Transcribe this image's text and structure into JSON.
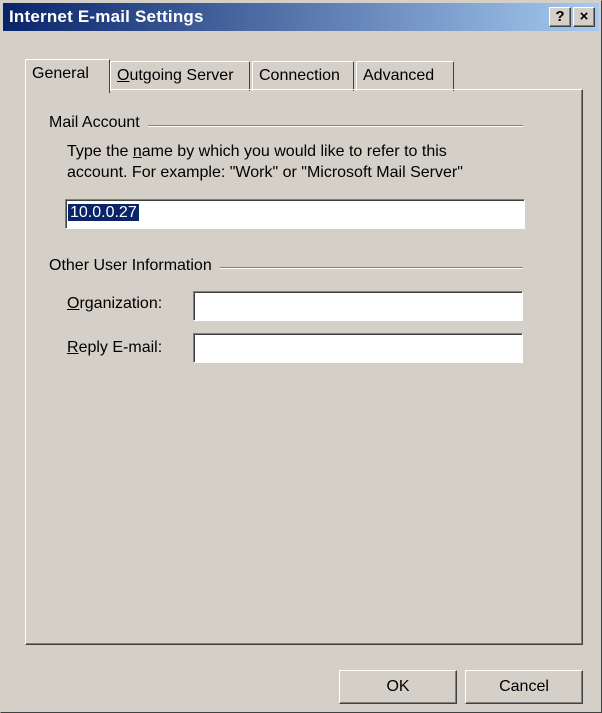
{
  "window": {
    "title": "Internet E-mail Settings",
    "help_label": "?",
    "close_label": "×"
  },
  "tabs": [
    {
      "label": "General",
      "active": true
    },
    {
      "label": "Outgoing Server",
      "underline": "O",
      "rest": "utgoing Server"
    },
    {
      "label": "Connection"
    },
    {
      "label": "Advanced"
    }
  ],
  "mail_account": {
    "group_title": "Mail Account",
    "description_line1_pre": "Type the ",
    "description_line1_ul": "n",
    "description_line1_post": "ame by which you would like to refer to this",
    "description_line2": "account.  For example: \"Work\" or \"Microsoft Mail Server\"",
    "account_name_value": "10.0.0.27"
  },
  "user_info": {
    "group_title": "Other User Information",
    "organization_ul": "O",
    "organization_rest": "rganization:",
    "organization_value": "",
    "reply_ul": "R",
    "reply_rest": "eply E-mail:",
    "reply_value": ""
  },
  "buttons": {
    "ok_label": "OK",
    "cancel_label": "Cancel"
  }
}
